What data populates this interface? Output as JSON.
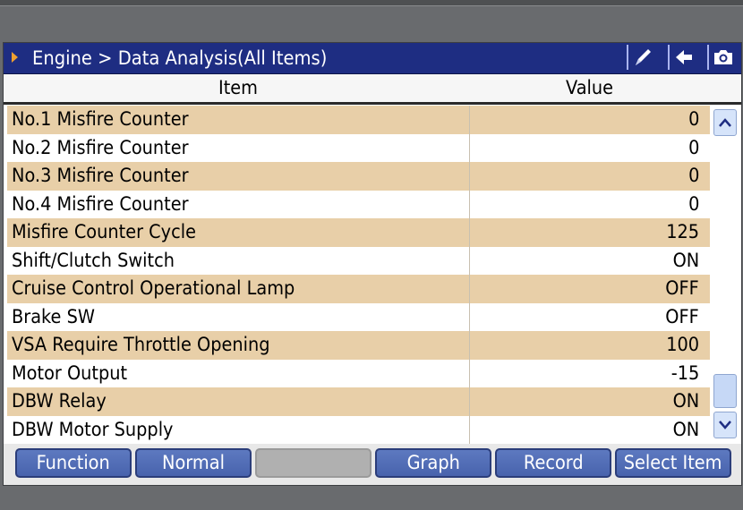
{
  "titlebar": {
    "breadcrumb": "Engine > Data Analysis(All Items)",
    "pen_icon": "pen-icon",
    "back_icon": "back-arrow-icon",
    "camera_icon": "camera-icon"
  },
  "table": {
    "header_item": "Item",
    "header_value": "Value",
    "rows": [
      {
        "item": "No.1 Misfire Counter",
        "value": "0"
      },
      {
        "item": "No.2 Misfire Counter",
        "value": "0"
      },
      {
        "item": "No.3 Misfire Counter",
        "value": "0"
      },
      {
        "item": "No.4 Misfire Counter",
        "value": "0"
      },
      {
        "item": "Misfire Counter Cycle",
        "value": "125"
      },
      {
        "item": "Shift/Clutch Switch",
        "value": "ON"
      },
      {
        "item": "Cruise Control Operational Lamp",
        "value": "OFF"
      },
      {
        "item": "Brake SW",
        "value": "OFF"
      },
      {
        "item": "VSA Require Throttle Opening",
        "value": "100"
      },
      {
        "item": "Motor Output",
        "value": "-15"
      },
      {
        "item": "DBW Relay",
        "value": "ON"
      },
      {
        "item": "DBW Motor Supply",
        "value": "ON"
      }
    ]
  },
  "buttons": {
    "function": "Function",
    "normal": "Normal",
    "blank": "",
    "graph": "Graph",
    "record": "Record",
    "select_item": "Select Item"
  },
  "colors": {
    "title_bar": "#1e2d82",
    "row_highlight": "#e8cfa8",
    "button": "#4f6bb4",
    "breadcrumb_arrow": "#f0a030"
  }
}
